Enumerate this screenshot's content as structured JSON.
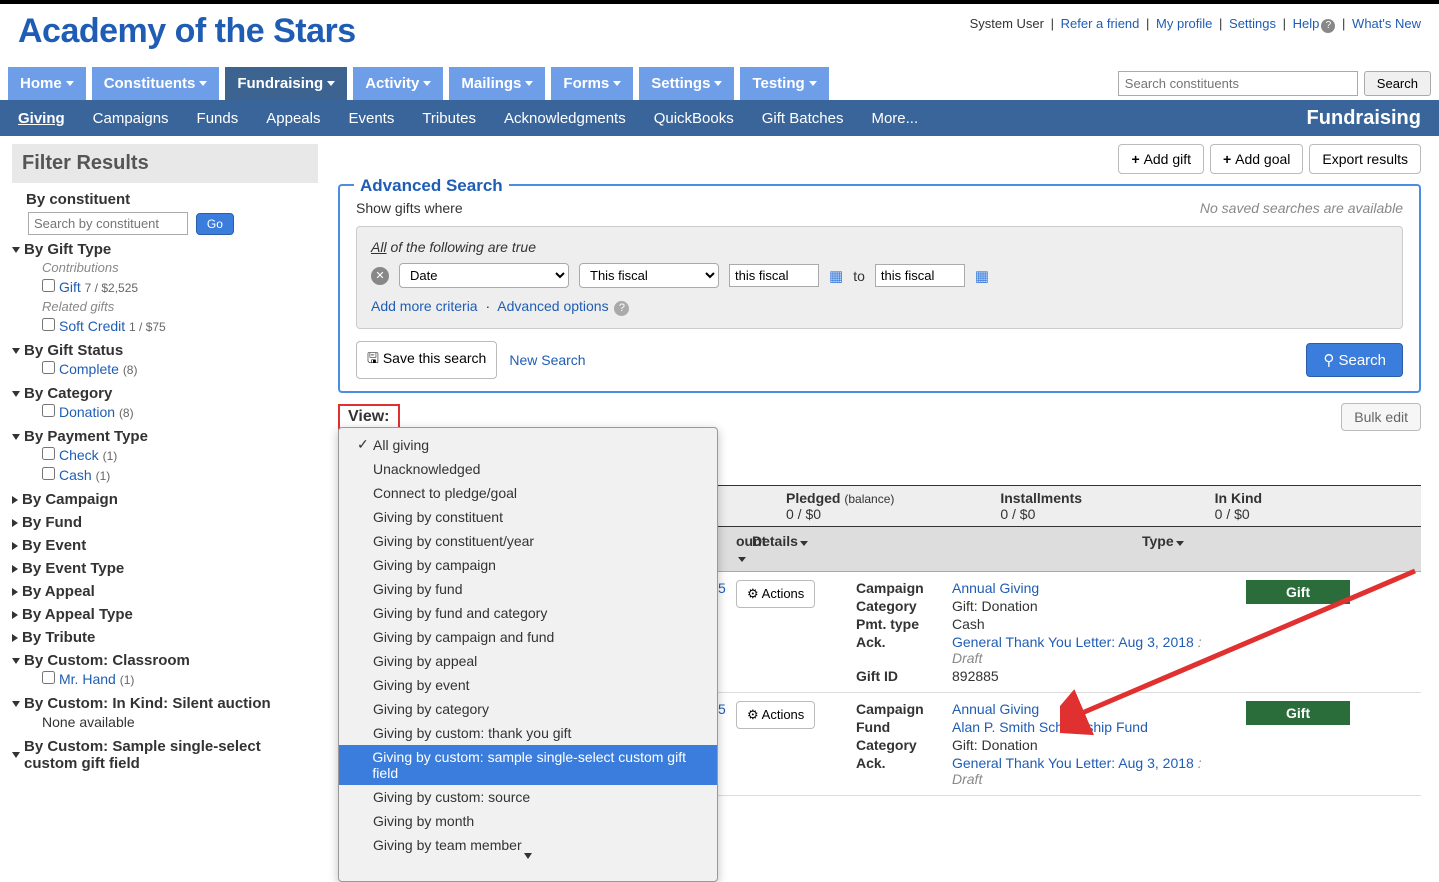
{
  "header": {
    "org_name": "Academy of the Stars",
    "user_label": "System User",
    "links": {
      "refer": "Refer a friend",
      "profile": "My profile",
      "settings": "Settings",
      "help": "Help",
      "whatsnew": "What's New"
    }
  },
  "nav": {
    "tabs": [
      "Home",
      "Constituents",
      "Fundraising",
      "Activity",
      "Mailings",
      "Forms",
      "Settings",
      "Testing"
    ],
    "active_tab": "Fundraising",
    "search_placeholder": "Search constituents",
    "search_button": "Search"
  },
  "subnav": {
    "items": [
      "Giving",
      "Campaigns",
      "Funds",
      "Appeals",
      "Events",
      "Tributes",
      "Acknowledgments",
      "QuickBooks",
      "Gift Batches",
      "More..."
    ],
    "active": "Giving",
    "title": "Fundraising"
  },
  "actions": {
    "add_gift": "Add gift",
    "add_goal": "Add goal",
    "export": "Export results",
    "bulk_edit": "Bulk edit"
  },
  "filters": {
    "title": "Filter Results",
    "by_constituent": {
      "heading": "By constituent",
      "placeholder": "Search by constituent",
      "go": "Go"
    },
    "by_gift_type": {
      "heading": "By Gift Type",
      "sub1": "Contributions",
      "gift_label": "Gift",
      "gift_count": "7 / $2,525",
      "sub2": "Related gifts",
      "soft_label": "Soft Credit",
      "soft_count": "1 / $75"
    },
    "by_gift_status": {
      "heading": "By Gift Status",
      "item": "Complete",
      "count": "(8)"
    },
    "by_category": {
      "heading": "By Category",
      "item": "Donation",
      "count": "(8)"
    },
    "by_payment": {
      "heading": "By Payment Type",
      "item1": "Check",
      "count1": "(1)",
      "item2": "Cash",
      "count2": "(1)"
    },
    "collapsed": [
      "By Campaign",
      "By Fund",
      "By Event",
      "By Event Type",
      "By Appeal",
      "By Appeal Type",
      "By Tribute"
    ],
    "by_custom_classroom": {
      "heading": "By Custom: Classroom",
      "item": "Mr. Hand",
      "count": "(1)"
    },
    "by_custom_silent": {
      "heading": "By Custom: In Kind: Silent auction",
      "none": "None available"
    },
    "by_custom_sample": {
      "heading": "By Custom: Sample single-select custom gift field"
    }
  },
  "adv_search": {
    "legend": "Advanced Search",
    "show_where": "Show gifts where",
    "no_saved": "No saved searches are available",
    "all_true_u": "All",
    "all_true_rest": " of the following are true",
    "field_select": "Date",
    "op_select": "This fiscal",
    "date_from": "this fiscal",
    "to_label": "to",
    "date_to": "this fiscal",
    "add_criteria": "Add more criteria",
    "adv_options": "Advanced options",
    "save_search": "Save this search",
    "new_search": "New Search",
    "search_btn": "Search"
  },
  "view": {
    "label": "View:",
    "options": [
      "All giving",
      "Unacknowledged",
      "Connect to pledge/goal",
      "Giving by constituent",
      "Giving by constituent/year",
      "Giving by campaign",
      "Giving by fund",
      "Giving by fund and category",
      "Giving by campaign and fund",
      "Giving by appeal",
      "Giving by event",
      "Giving by category",
      "Giving by custom: thank you gift",
      "Giving by custom: sample single-select custom gift field",
      "Giving by custom: source",
      "Giving by month",
      "Giving by team member"
    ],
    "checked": "All giving",
    "selected": "Giving by custom: sample single-select custom gift field"
  },
  "summary": {
    "pledged_label": "Pledged",
    "balance_label": "(balance)",
    "pledged_val": "0 / $0",
    "installments_label": "Installments",
    "installments_val": "0 / $0",
    "inkind_label": "In Kind",
    "inkind_val": "0 / $0"
  },
  "table": {
    "headers": {
      "amount": "ount",
      "details": "Details",
      "type": "Type"
    },
    "actions_label": "Actions",
    "gift_pill": "Gift",
    "rows": [
      {
        "amount_frag": "5",
        "details": {
          "campaign_lbl": "Campaign",
          "campaign": "Annual Giving",
          "category_lbl": "Category",
          "category": "Gift: Donation",
          "pmt_lbl": "Pmt. type",
          "pmt": "Cash",
          "ack_lbl": "Ack.",
          "ack": "General Thank You Letter: Aug 3, 2018",
          "ack_draft": ": Draft",
          "giftid_lbl": "Gift ID",
          "giftid": "892885"
        }
      },
      {
        "amount_frag": "5",
        "details": {
          "campaign_lbl": "Campaign",
          "campaign": "Annual Giving",
          "fund_lbl": "Fund",
          "fund": "Alan P. Smith Scholarship Fund",
          "category_lbl": "Category",
          "category": "Gift: Donation",
          "ack_lbl": "Ack.",
          "ack": "General Thank You Letter: Aug 3, 2018",
          "ack_draft": ": Draft"
        }
      }
    ]
  }
}
